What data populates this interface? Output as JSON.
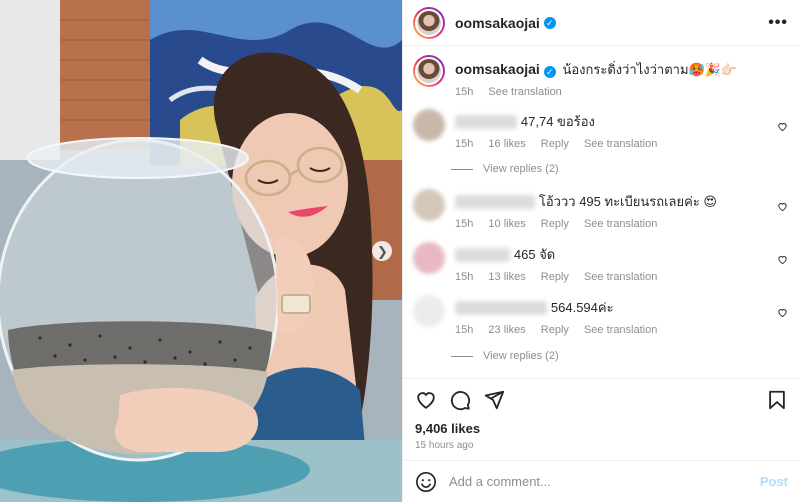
{
  "header": {
    "username": "oomsakaojai",
    "more": "•••"
  },
  "caption": {
    "username": "oomsakaojai",
    "text": "น้องกระดิ่งว่าไงว่าตาม🥵🎉👉🏻",
    "time": "15h",
    "translation": "See translation"
  },
  "comments": [
    {
      "text": "47,74 ขอร้อง",
      "time": "15h",
      "likes": "16 likes",
      "reply": "Reply",
      "translation": "See translation",
      "view_replies": "View replies (2)"
    },
    {
      "text": "โอ้ววว 495 ทะเบียนรถเลยค่ะ 😍",
      "time": "15h",
      "likes": "10 likes",
      "reply": "Reply",
      "translation": "See translation"
    },
    {
      "text": "465 จัด",
      "time": "15h",
      "likes": "13 likes",
      "reply": "Reply",
      "translation": "See translation"
    },
    {
      "text": "564.594ค่ะ",
      "time": "15h",
      "likes": "23 likes",
      "reply": "Reply",
      "translation": "See translation",
      "view_replies": "View replies (2)"
    }
  ],
  "footer": {
    "likes": "9,406 likes",
    "time_ago": "15 hours ago",
    "comment_placeholder": "Add a comment...",
    "post": "Post"
  },
  "icons": [
    "heart-icon",
    "comment-icon",
    "share-icon",
    "bookmark-icon",
    "emoji-icon",
    "verified-icon",
    "chevron-right-icon",
    "more-icon"
  ],
  "colors": {
    "verified": "#0095f6",
    "post_button": "#b2dffc",
    "secondary_text": "#8e8e8e",
    "lips": "#e8466a"
  }
}
